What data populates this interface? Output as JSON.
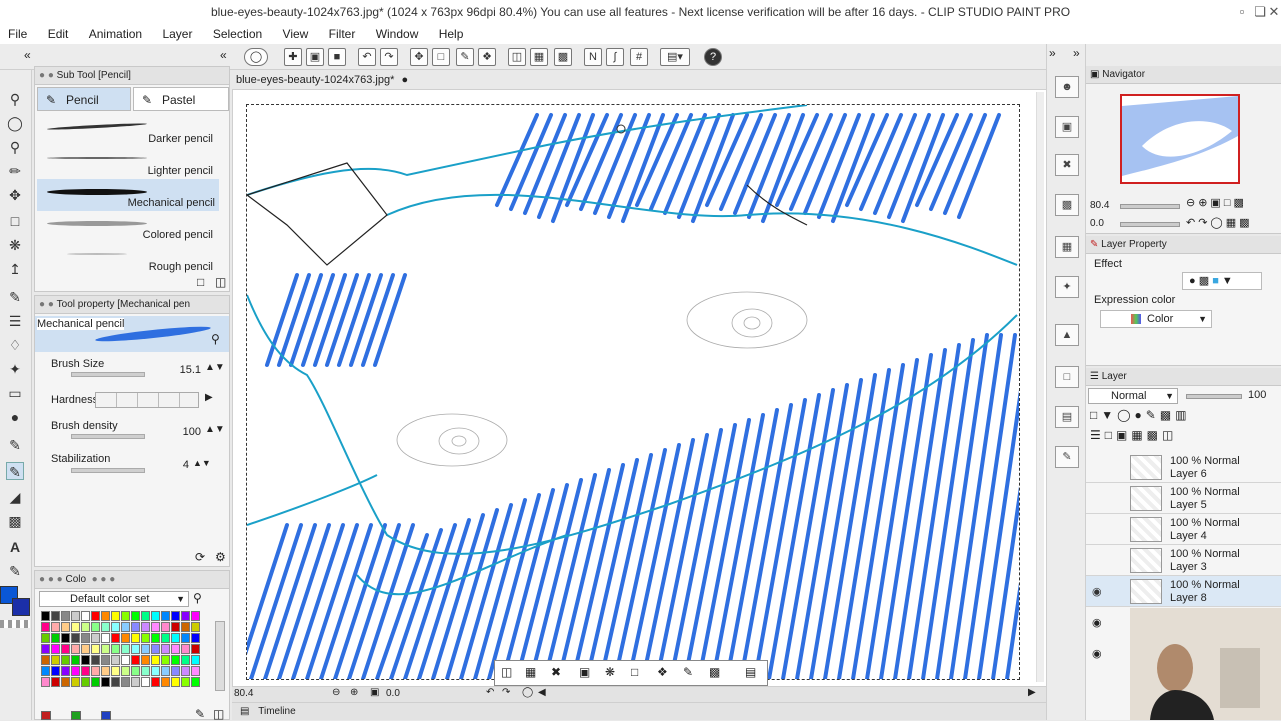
{
  "window": {
    "title": "blue-eyes-beauty-1024x763.jpg* (1024 x 763px 96dpi 80.4%)  You can use all features - Next license verification will be after 16 days. - CLIP STUDIO PAINT PRO"
  },
  "menu": [
    "File",
    "Edit",
    "Animation",
    "Layer",
    "Selection",
    "View",
    "Filter",
    "Window",
    "Help"
  ],
  "subtool": {
    "header": "Sub Tool [Pencil]",
    "tabs": [
      "Pencil",
      "Pastel"
    ],
    "brushes": [
      "Darker pencil",
      "Lighter pencil",
      "Mechanical pencil",
      "Colored pencil",
      "Rough pencil"
    ],
    "selected_brush": "Mechanical pencil"
  },
  "toolprop": {
    "header": "Tool property [Mechanical pen",
    "preset_name": "Mechanical pencil",
    "brush_size_label": "Brush Size",
    "brush_size_value": "15.1",
    "hardness_label": "Hardness",
    "density_label": "Brush density",
    "density_value": "100",
    "stabilization_label": "Stabilization",
    "stabilization_value": "4"
  },
  "colorset": {
    "header": "Colo",
    "set_name": "Default color set",
    "main_color": "#0a57d6",
    "sub_color": "#1b2fa8"
  },
  "document": {
    "tab": "blue-eyes-beauty-1024x763.jpg*",
    "zoom": "80.4",
    "angle": "0.0",
    "timeline_label": "Timeline",
    "stroke_color": "#2f6fe0",
    "outline_color": "#1aa0c8"
  },
  "navigator": {
    "header": "Navigator",
    "zoom": "80.4",
    "angle": "0.0"
  },
  "layerprop": {
    "header": "Layer Property",
    "effect_label": "Effect",
    "expression_label": "Expression color",
    "expression_value": "Color"
  },
  "layers": {
    "header": "Layer",
    "blend_mode": "Normal",
    "opacity": "100",
    "items": [
      {
        "line1": "100 % Normal",
        "line2": "Layer 6",
        "visible": false,
        "selected": false
      },
      {
        "line1": "100 % Normal",
        "line2": "Layer 5",
        "visible": false,
        "selected": false
      },
      {
        "line1": "100 % Normal",
        "line2": "Layer 4",
        "visible": false,
        "selected": false
      },
      {
        "line1": "100 % Normal",
        "line2": "Layer 3",
        "visible": false,
        "selected": false
      },
      {
        "line1": "100 % Normal",
        "line2": "Layer 8",
        "visible": true,
        "selected": true
      }
    ]
  }
}
